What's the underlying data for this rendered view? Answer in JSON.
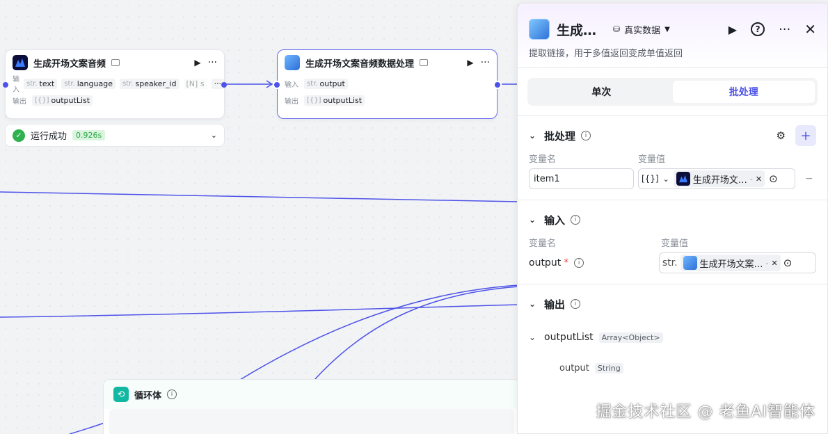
{
  "nodes": {
    "audio": {
      "title": "生成开场文案音频",
      "in_label": "输入",
      "out_label": "输出",
      "inputs": [
        {
          "prefix": "str.",
          "name": "text"
        },
        {
          "prefix": "str.",
          "name": "language"
        },
        {
          "prefix": "str.",
          "name": "speaker_id"
        },
        {
          "prefix": "",
          "name": "[N] s"
        }
      ],
      "more": "···",
      "output": {
        "prefix": "[{}]",
        "name": "outputList"
      },
      "run_status": "运行成功",
      "run_time": "0.926s"
    },
    "process": {
      "title": "生成开场文案音频数据处理",
      "in_label": "输入",
      "out_label": "输出",
      "input": {
        "prefix": "str.",
        "name": "output"
      },
      "output": {
        "prefix": "[{}]",
        "name": "outputList"
      }
    },
    "loop": {
      "title": "循环体"
    }
  },
  "panel": {
    "title": "生成…",
    "data_mode": "真实数据",
    "description": "提取链接，用于多值返回变成单值返回",
    "tabs": [
      "单次",
      "批处理"
    ],
    "active_tab": "批处理",
    "batch": {
      "title": "批处理",
      "col_name": "变量名",
      "col_value": "变量值",
      "var_name": "item1",
      "type_prefix": "[{}]",
      "ref_text": "生成开场文…",
      "ref_suffix": "-",
      "remove": "−"
    },
    "input": {
      "title": "输入",
      "col_name": "变量名",
      "col_value": "变量值",
      "var_name": "output",
      "required": "*",
      "type_prefix": "str.",
      "ref_text": "生成开场文案…",
      "ref_suffix": "-"
    },
    "output": {
      "title": "输出",
      "list_name": "outputList",
      "list_type": "Array<Object>",
      "child_name": "output",
      "child_type": "String"
    }
  },
  "watermark": "掘金技术社区 @ 老鱼AI智能体",
  "colors": {
    "accent": "#4d53e8",
    "success": "#2fb14f",
    "loop": "#11b8a1"
  }
}
